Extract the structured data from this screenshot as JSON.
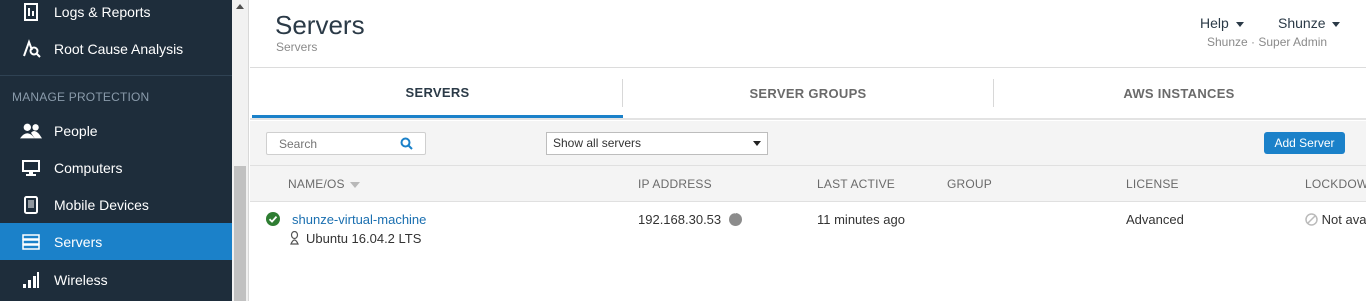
{
  "sidebar": {
    "items": [
      {
        "label": "Logs & Reports",
        "icon": "report-icon"
      },
      {
        "label": "Root Cause Analysis",
        "icon": "root-cause-icon"
      },
      {
        "label": "People",
        "icon": "people-icon"
      },
      {
        "label": "Computers",
        "icon": "computer-icon"
      },
      {
        "label": "Mobile Devices",
        "icon": "mobile-icon"
      },
      {
        "label": "Servers",
        "icon": "server-icon"
      },
      {
        "label": "Wireless",
        "icon": "wireless-icon"
      }
    ],
    "section_label": "MANAGE PROTECTION",
    "active_item": "Servers"
  },
  "header": {
    "title": "Servers",
    "breadcrumb": "Servers",
    "help_label": "Help",
    "user_label": "Shunze",
    "role_text": "Shunze · Super Admin"
  },
  "tabs": [
    {
      "label": "SERVERS",
      "active": true
    },
    {
      "label": "SERVER GROUPS",
      "active": false
    },
    {
      "label": "AWS INSTANCES",
      "active": false
    }
  ],
  "toolbar": {
    "search_placeholder": "Search",
    "filter_selected": "Show all servers",
    "add_button_label": "Add Server"
  },
  "table": {
    "columns": [
      "NAME/OS",
      "IP ADDRESS",
      "LAST ACTIVE",
      "GROUP",
      "LICENSE",
      "LOCKDOWN"
    ],
    "rows": [
      {
        "name": "shunze-virtual-machine",
        "os": "Ubuntu 16.04.2 LTS",
        "ip": "192.168.30.53",
        "last_active": "11 minutes ago",
        "group": "",
        "license": "Advanced",
        "lockdown": "Not ava"
      }
    ]
  },
  "colors": {
    "sidebar_bg": "#1e2d3b",
    "accent": "#1b81c9",
    "status_ok": "#2e7d32",
    "link": "#1a6fb0"
  }
}
